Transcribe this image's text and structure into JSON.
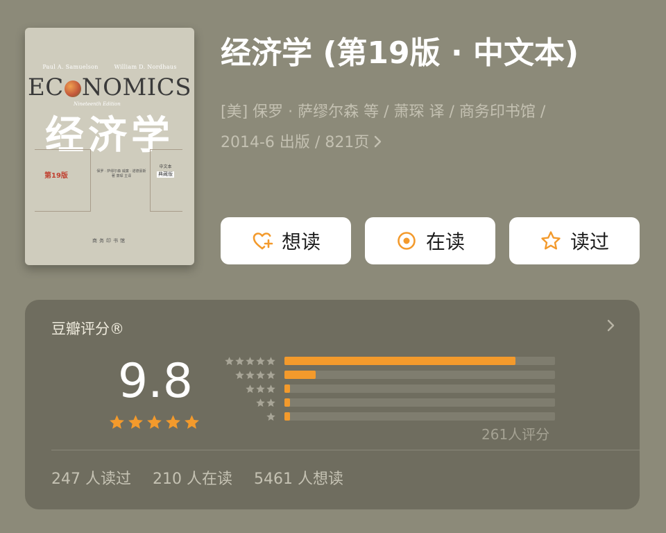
{
  "book": {
    "title": "经济学 (第19版 · 中文本)",
    "meta_line1": "[美] 保罗 · 萨缪尔森 等 / 萧琛 译 / 商务印书馆 /",
    "meta_line2": "2014-6 出版 / 821页"
  },
  "cover": {
    "author1": "Paul A. Samuelson",
    "author2": "William D. Nordhaus",
    "econ_prefix": "EC",
    "econ_suffix": "NOMICS",
    "edition_en": "Nineteenth Edition",
    "cn_title": "经济学",
    "edition_num": "第19版",
    "side_line1": "中文本",
    "side_tag": "典藏版",
    "mid_text": "保罗 · 萨缪尔森 威廉 · 诺德豪斯 著 萧琛 主译",
    "publisher": "商务印书馆"
  },
  "actions": {
    "want": "想读",
    "reading": "在读",
    "read": "读过"
  },
  "rating": {
    "title": "豆瓣评分®",
    "score": "9.8",
    "stars": 5,
    "count_label": "261人评分",
    "distribution": [
      {
        "stars": 5,
        "fraction": 0.855
      },
      {
        "stars": 4,
        "fraction": 0.115
      },
      {
        "stars": 3,
        "fraction": 0.02
      },
      {
        "stars": 2,
        "fraction": 0.02
      },
      {
        "stars": 1,
        "fraction": 0.02
      }
    ]
  },
  "stats": {
    "read": "247 人读过",
    "reading": "210 人在读",
    "want": "5461 人想读"
  },
  "colors": {
    "background": "#8c8a79",
    "card": "#6f6d5f",
    "accent": "#f39a2c",
    "button": "#ffffff"
  }
}
